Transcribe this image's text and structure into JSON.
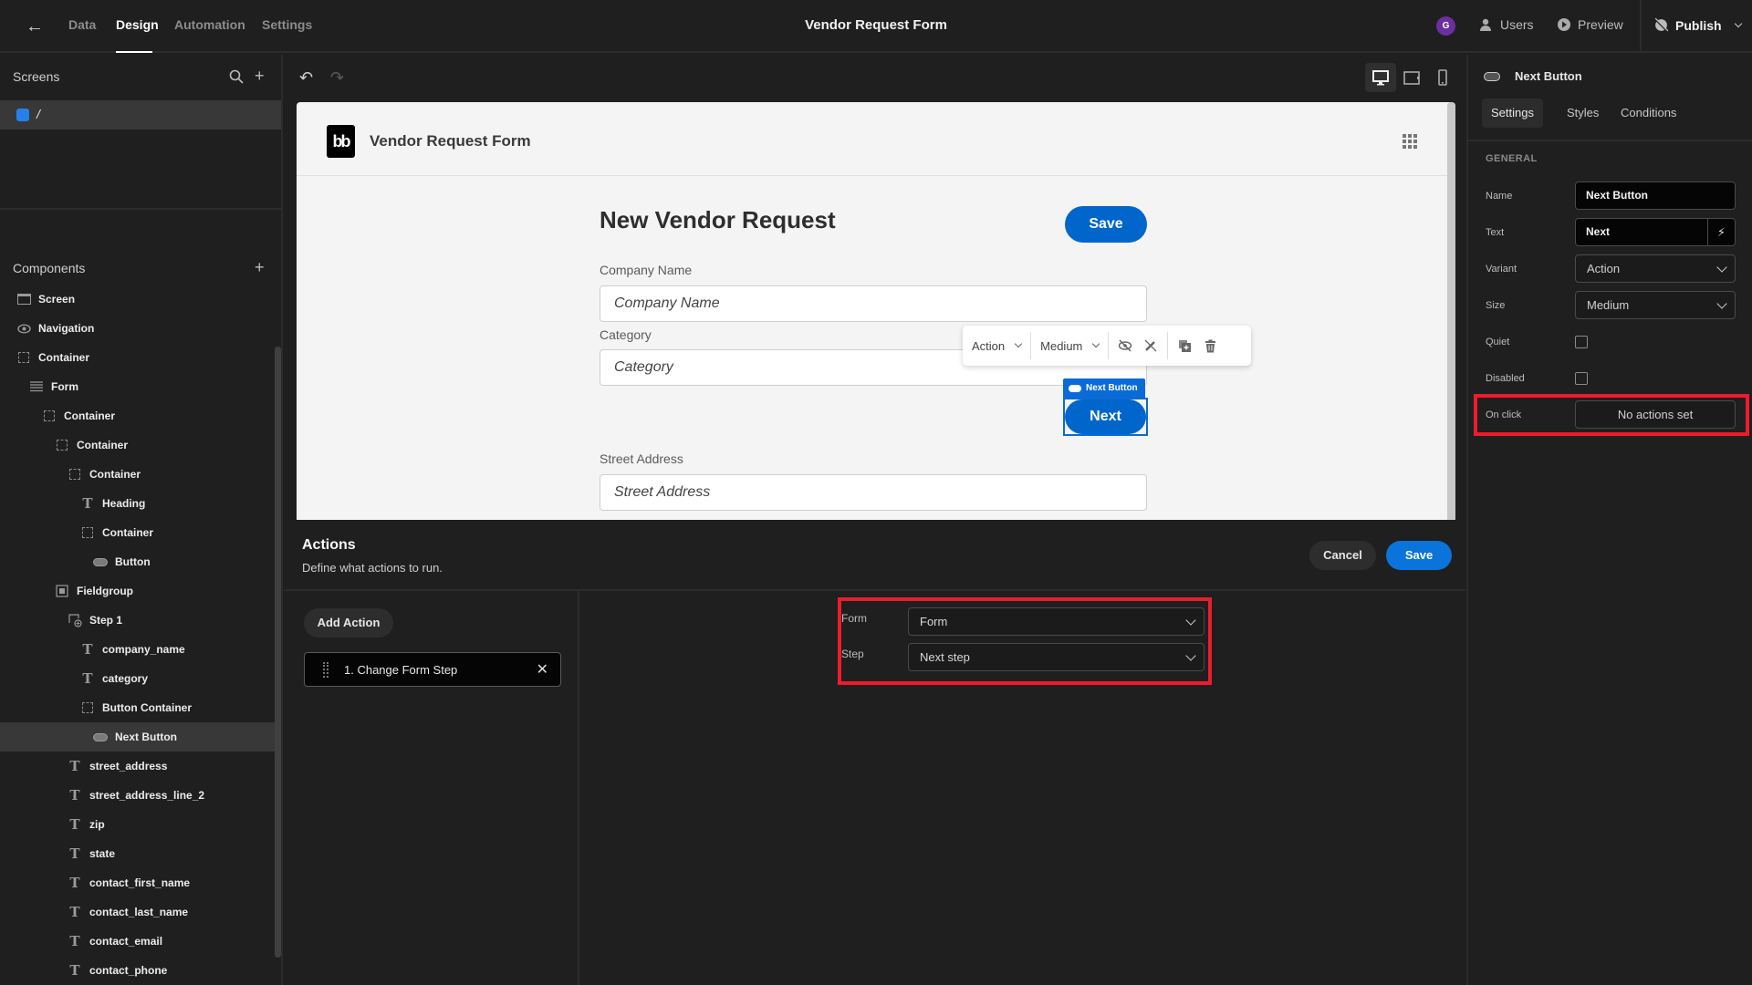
{
  "topbar": {
    "tabs": [
      {
        "label": "Data",
        "active": false
      },
      {
        "label": "Design",
        "active": true
      },
      {
        "label": "Automation",
        "active": false
      },
      {
        "label": "Settings",
        "active": false
      }
    ],
    "app_title": "Vendor Request Form",
    "avatar_initial": "G",
    "avatar_color": "#6b2fa0",
    "users_label": "Users",
    "preview_label": "Preview",
    "publish_label": "Publish"
  },
  "sidebar": {
    "screens_heading": "Screens",
    "screens": [
      {
        "label": "/",
        "color": "#2680eb",
        "selected": true
      }
    ],
    "components_heading": "Components",
    "components": [
      {
        "label": "Screen",
        "icon": "screen",
        "depth": 0
      },
      {
        "label": "Navigation",
        "icon": "eye",
        "depth": 0
      },
      {
        "label": "Container",
        "icon": "container",
        "depth": 0
      },
      {
        "label": "Form",
        "icon": "form",
        "depth": 1
      },
      {
        "label": "Container",
        "icon": "container",
        "depth": 2
      },
      {
        "label": "Container",
        "icon": "container",
        "depth": 3
      },
      {
        "label": "Container",
        "icon": "container",
        "depth": 4
      },
      {
        "label": "Heading",
        "icon": "heading",
        "depth": 5
      },
      {
        "label": "Container",
        "icon": "container",
        "depth": 5
      },
      {
        "label": "Button",
        "icon": "button",
        "depth": 6
      },
      {
        "label": "Fieldgroup",
        "icon": "fieldgroup",
        "depth": 3
      },
      {
        "label": "Step 1",
        "icon": "step",
        "depth": 4
      },
      {
        "label": "company_name",
        "icon": "text",
        "depth": 5
      },
      {
        "label": "category",
        "icon": "text",
        "depth": 5
      },
      {
        "label": "Button Container",
        "icon": "container",
        "depth": 5
      },
      {
        "label": "Next Button",
        "icon": "button",
        "depth": 6,
        "selected": true
      },
      {
        "label": "street_address",
        "icon": "text",
        "depth": 4
      },
      {
        "label": "street_address_line_2",
        "icon": "text",
        "depth": 4
      },
      {
        "label": "zip",
        "icon": "text",
        "depth": 4
      },
      {
        "label": "state",
        "icon": "text",
        "depth": 4
      },
      {
        "label": "contact_first_name",
        "icon": "text",
        "depth": 4
      },
      {
        "label": "contact_last_name",
        "icon": "text",
        "depth": 4
      },
      {
        "label": "contact_email",
        "icon": "text",
        "depth": 4
      },
      {
        "label": "contact_phone",
        "icon": "text",
        "depth": 4
      }
    ]
  },
  "preview": {
    "logo_text": "bb",
    "app_name": "Vendor Request Form",
    "form_title": "New Vendor Request",
    "save_label": "Save",
    "fields": [
      {
        "label": "Company Name",
        "placeholder": "Company Name"
      },
      {
        "label": "Category",
        "placeholder": "Category"
      },
      {
        "label": "Street Address",
        "placeholder": "Street Address"
      }
    ],
    "floating_toolbar": {
      "variant": "Action",
      "size": "Medium"
    },
    "selection_tag": "Next Button",
    "next_label": "Next",
    "accent": "#0066cc"
  },
  "actions_panel": {
    "title": "Actions",
    "subtitle": "Define what actions to run.",
    "cancel_label": "Cancel",
    "save_label": "Save",
    "add_action_label": "Add Action",
    "actions": [
      {
        "label": "1. Change Form Step"
      }
    ],
    "params": [
      {
        "label": "Form",
        "value": "Form"
      },
      {
        "label": "Step",
        "value": "Next step"
      }
    ]
  },
  "right_panel": {
    "component_name": "Next Button",
    "tabs": [
      {
        "label": "Settings",
        "active": true
      },
      {
        "label": "Styles",
        "active": false
      },
      {
        "label": "Conditions",
        "active": false
      }
    ],
    "section": "GENERAL",
    "name_label": "Name",
    "name_value": "Next Button",
    "text_label": "Text",
    "text_value": "Next",
    "variant_label": "Variant",
    "variant_value": "Action",
    "size_label": "Size",
    "size_value": "Medium",
    "quiet_label": "Quiet",
    "quiet_checked": false,
    "disabled_label": "Disabled",
    "disabled_checked": false,
    "onclick_label": "On click",
    "onclick_value": "No actions set"
  },
  "highlight_color": "#ec1c2c"
}
